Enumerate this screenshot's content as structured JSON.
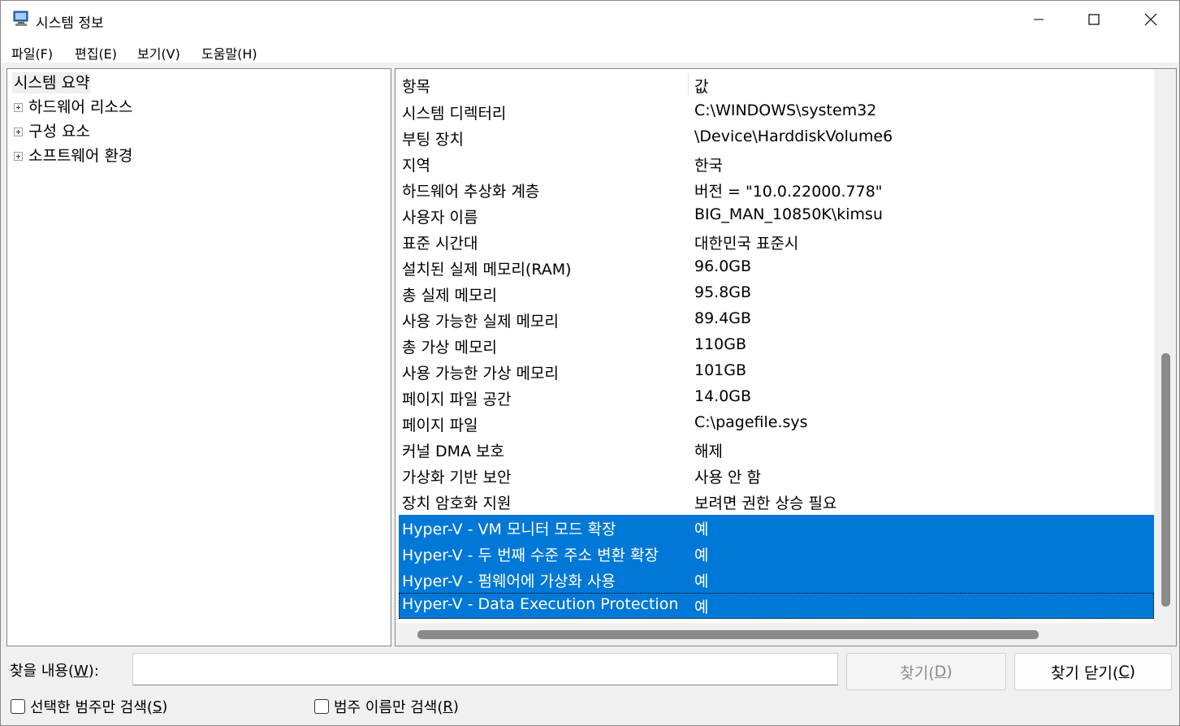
{
  "window": {
    "title": "시스템 정보",
    "controls": {
      "minimize": "minimize",
      "maximize": "maximize",
      "close": "close"
    }
  },
  "menu": {
    "items": [
      "파일(F)",
      "편집(E)",
      "보기(V)",
      "도움말(H)"
    ]
  },
  "tree": {
    "root": "시스템 요약",
    "children": [
      "하드웨어 리소스",
      "구성 요소",
      "소프트웨어 환경"
    ]
  },
  "list": {
    "headers": {
      "item": "항목",
      "value": "값"
    },
    "rows": [
      {
        "name": "시스템 디렉터리",
        "value": "C:\\WINDOWS\\system32",
        "selected": false
      },
      {
        "name": "부팅 장치",
        "value": "\\Device\\HarddiskVolume6",
        "selected": false
      },
      {
        "name": "지역",
        "value": "한국",
        "selected": false
      },
      {
        "name": "하드웨어 추상화 계층",
        "value": "버전 = \"10.0.22000.778\"",
        "selected": false
      },
      {
        "name": "사용자 이름",
        "value": "BIG_MAN_10850K\\kimsu",
        "selected": false
      },
      {
        "name": "표준 시간대",
        "value": "대한민국 표준시",
        "selected": false
      },
      {
        "name": "설치된 실제 메모리(RAM)",
        "value": "96.0GB",
        "selected": false
      },
      {
        "name": "총 실제 메모리",
        "value": "95.8GB",
        "selected": false
      },
      {
        "name": "사용 가능한 실제 메모리",
        "value": "89.4GB",
        "selected": false
      },
      {
        "name": "총 가상 메모리",
        "value": "110GB",
        "selected": false
      },
      {
        "name": "사용 가능한 가상 메모리",
        "value": "101GB",
        "selected": false
      },
      {
        "name": "페이지 파일 공간",
        "value": "14.0GB",
        "selected": false
      },
      {
        "name": "페이지 파일",
        "value": "C:\\pagefile.sys",
        "selected": false
      },
      {
        "name": "커널 DMA 보호",
        "value": "해제",
        "selected": false
      },
      {
        "name": "가상화 기반 보안",
        "value": "사용 안 함",
        "selected": false
      },
      {
        "name": "장치 암호화 지원",
        "value": "보려면 권한 상승 필요",
        "selected": false
      },
      {
        "name": "Hyper-V - VM 모니터 모드 확장",
        "value": "예",
        "selected": true
      },
      {
        "name": "Hyper-V - 두 번째 수준 주소 변환 확장",
        "value": "예",
        "selected": true
      },
      {
        "name": "Hyper-V - 펌웨어에 가상화 사용",
        "value": "예",
        "selected": true
      },
      {
        "name": "Hyper-V - Data Execution Protection",
        "value": "예",
        "selected": true
      }
    ]
  },
  "find": {
    "label_prefix": "찾을 내용(",
    "label_key": "W",
    "label_suffix": "):",
    "input_value": "",
    "find_button": {
      "prefix": "찾기(",
      "key": "D",
      "suffix": ")"
    },
    "close_button": {
      "prefix": "찾기 닫기(",
      "key": "C",
      "suffix": ")"
    },
    "option_selected_category": {
      "prefix": "선택한 범주만 검색(",
      "key": "S",
      "suffix": ")"
    },
    "option_category_names": {
      "prefix": "범주 이름만 검색(",
      "key": "R",
      "suffix": ")"
    }
  },
  "colors": {
    "selection": "#0078d7",
    "window_bg": "#f0f0f0",
    "disabled_text": "#8c8c8c"
  }
}
